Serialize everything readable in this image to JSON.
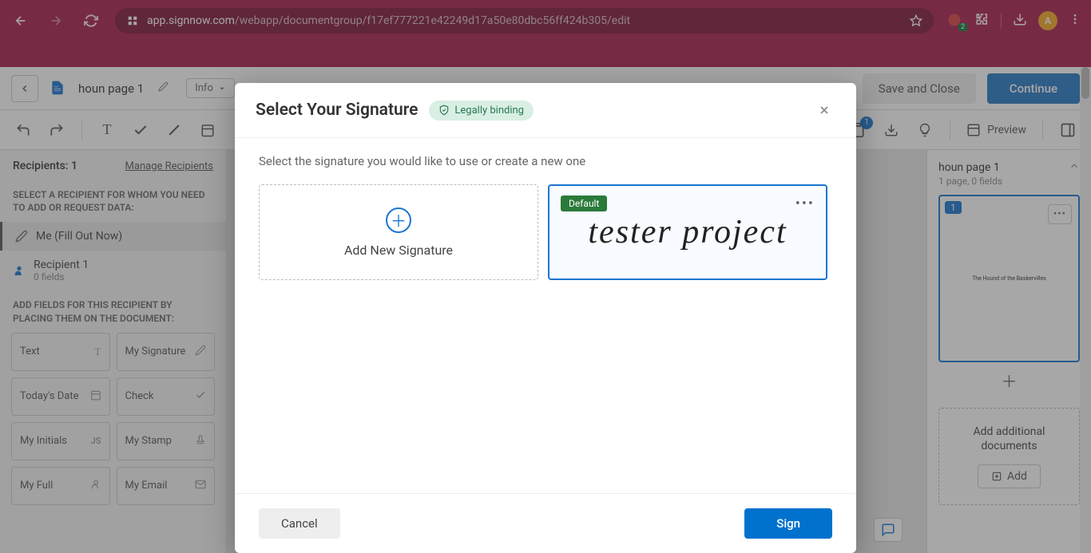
{
  "browser": {
    "url_domain": "app.signnow.com",
    "url_path": "/webapp/documentgroup/f17ef777221e42249d17a50e80dbc56ff424b305/edit",
    "ext_badge": "2",
    "avatar_letter": "A"
  },
  "header": {
    "doc_title": "houn page 1",
    "info_label": "Info",
    "save_label": "Save and Close",
    "continue_label": "Continue"
  },
  "toolbar": {
    "preview_label": "Preview",
    "notif_count": "1"
  },
  "left": {
    "recipients_label": "Recipients: 1",
    "manage_label": "Manage Recipients",
    "select_heading": "SELECT A RECIPIENT FOR WHOM YOU NEED TO ADD OR REQUEST DATA:",
    "me_label": "Me (Fill Out Now)",
    "r1_name": "Recipient 1",
    "r1_sub": "0 fields",
    "fields_heading": "ADD FIELDS FOR THIS RECIPIENT BY PLACING THEM ON THE DOCUMENT:",
    "tiles": {
      "text": "Text",
      "signature": "My Signature",
      "date": "Today's Date",
      "check": "Check",
      "initials": "My Initials",
      "stamp": "My Stamp",
      "full": "My Full",
      "email": "My Email"
    }
  },
  "right": {
    "title": "houn page 1",
    "sub": "1 page, 0 fields",
    "thumb_badge": "1",
    "thumb_text": "The Hound of the Baskervilles",
    "add_docs_title": "Add additional documents",
    "add_btn": "Add"
  },
  "modal": {
    "title": "Select Your Signature",
    "legal": "Legally binding",
    "instruction": "Select the signature you would like to use or create a new one",
    "add_new_label": "Add New Signature",
    "default_badge": "Default",
    "signature_text": "tester project",
    "cancel_label": "Cancel",
    "sign_label": "Sign"
  }
}
